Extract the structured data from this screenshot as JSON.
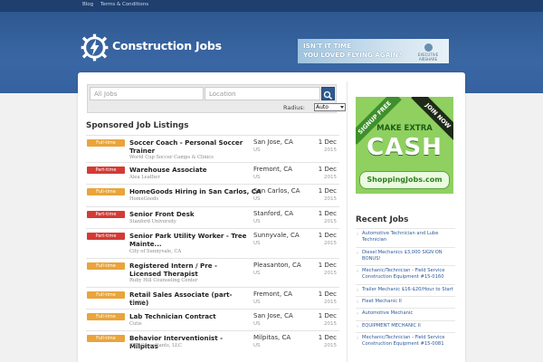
{
  "topnav": {
    "blog": "Blog",
    "terms": "Terms & Conditions"
  },
  "header": {
    "site_name": "Construction Jobs"
  },
  "header_ad": {
    "line1": "ISN'T IT TIME",
    "line2": "YOU LOVED FLYING AGAIN?",
    "brand_line1": "EXECUTIVE",
    "brand_line2": "AIRSHARE"
  },
  "search": {
    "keyword_placeholder": "All Jobs",
    "location_placeholder": "Location",
    "radius_label": "Radius:",
    "radius_value": "Auto"
  },
  "listings_title": "Sponsored Job Listings",
  "jobs": [
    {
      "type": "Full-time",
      "type_color": "#e9a43b",
      "title": "Soccer Coach - Personal Soccer Trainer",
      "company": "World Cup Soccer Camps & Clinics",
      "location": "San Jose, CA",
      "country": "US",
      "date": "1 Dec",
      "year": "2015"
    },
    {
      "type": "Part-time",
      "type_color": "#d23b35",
      "title": "Warehouse Associate",
      "company": "Alea Leather",
      "location": "Fremont, CA",
      "country": "US",
      "date": "1 Dec",
      "year": "2015"
    },
    {
      "type": "Full-time",
      "type_color": "#e9a43b",
      "title": "HomeGoods Hiring in San Carlos, CA",
      "company": "HomeGoods",
      "location": "San Carlos, CA",
      "country": "US",
      "date": "1 Dec",
      "year": "2015"
    },
    {
      "type": "Part-time",
      "type_color": "#d23b35",
      "title": "Senior Front Desk",
      "company": "Stanford University",
      "location": "Stanford, CA",
      "country": "US",
      "date": "1 Dec",
      "year": "2015"
    },
    {
      "type": "Part-time",
      "type_color": "#d23b35",
      "title": "Senior Park Utility Worker - Tree Mainte...",
      "company": "City of Sunnyvale, CA",
      "location": "Sunnyvale, CA",
      "country": "US",
      "date": "1 Dec",
      "year": "2015"
    },
    {
      "type": "Full-time",
      "type_color": "#e9a43b",
      "title": "Registered Intern / Pre - Licensed Therapist",
      "company": "Ruby Hill Counseling Center",
      "location": "Pleasanton, CA",
      "country": "US",
      "date": "1 Dec",
      "year": "2015"
    },
    {
      "type": "Full-time",
      "type_color": "#e9a43b",
      "title": "Retail Sales Associate (part-time)",
      "company": "Sprint",
      "location": "Fremont, CA",
      "country": "US",
      "date": "1 Dec",
      "year": "2015"
    },
    {
      "type": "Full-time",
      "type_color": "#e9a43b",
      "title": "Lab Technician Contract",
      "company": "Cutis",
      "location": "San Jose, CA",
      "country": "US",
      "date": "1 Dec",
      "year": "2015"
    },
    {
      "type": "Full-time",
      "type_color": "#e9a43b",
      "title": "Behavior Interventionist - Milpitas",
      "company": "STE Consultants, LLC",
      "location": "Milpitas, CA",
      "country": "US",
      "date": "1 Dec",
      "year": "2015"
    }
  ],
  "side_ad": {
    "ribbon_left": "SIGNUP FREE",
    "ribbon_right": "JOIN NOW",
    "line1": "MAKE EXTRA",
    "line2": "CASH",
    "site": "ShoppingJobs.com"
  },
  "recent_title": "Recent Jobs",
  "recent_jobs": [
    "Automotive Technician and Lube Technician",
    "Diesel Mechanics $3,000 SIGN ON BONUS!",
    "Mechanic/Technician - Field Service Construction Equipment #15-0160",
    "Trailer Mechanic $16-$20/Hour to Start",
    "Fleet Mechanic II",
    "Automotive Mechanic",
    "EQUIPMENT MECHANIC II",
    "Mechanic/Technician - Field Service Construction Equipment #15-0081"
  ],
  "colors": {
    "header_blue": "#3561a0",
    "full_time": "#e9a43b",
    "part_time": "#d23b35",
    "link": "#2d5a9a"
  }
}
